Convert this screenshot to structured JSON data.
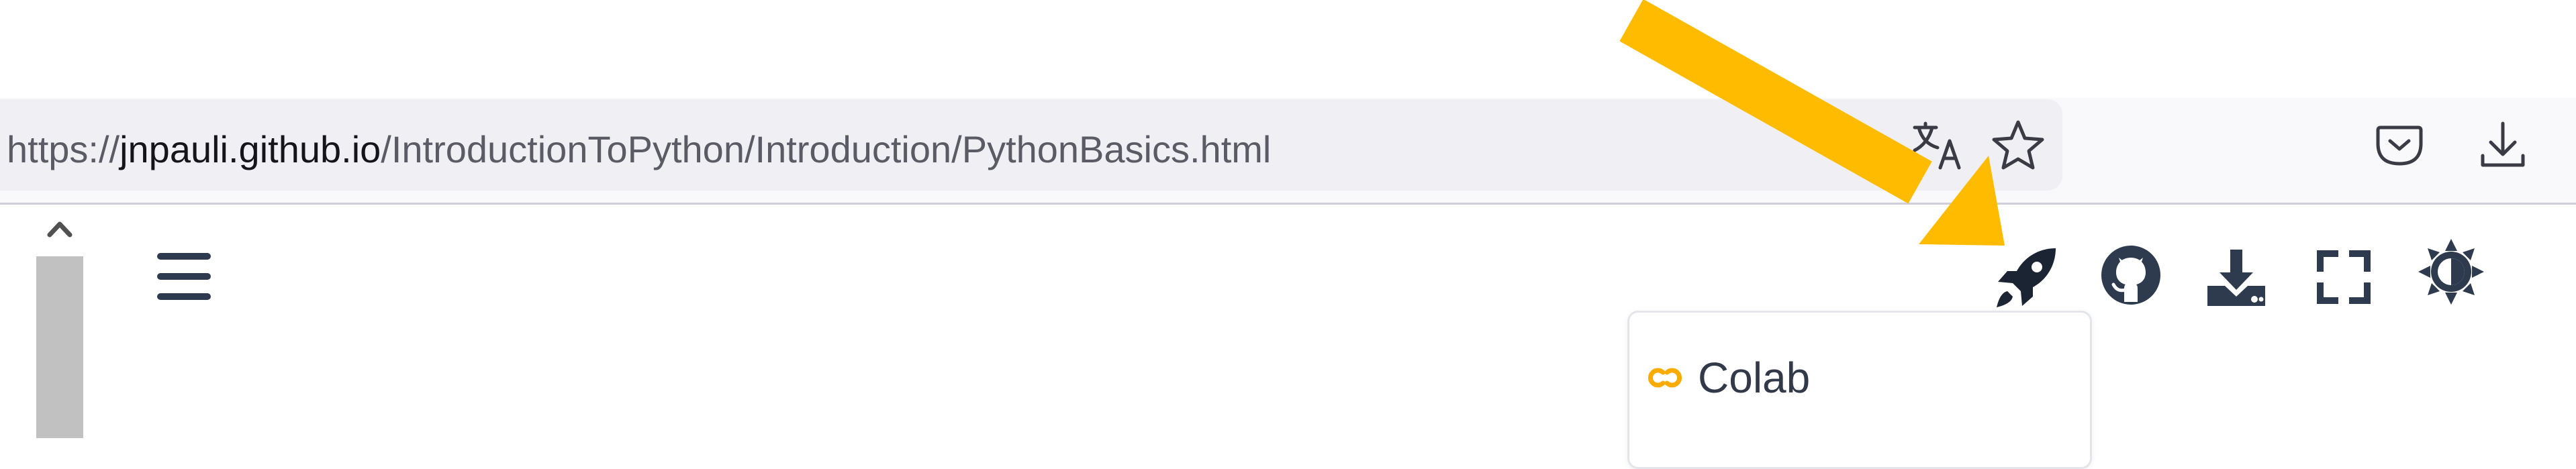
{
  "browser": {
    "url_prefix": "https://",
    "url_host": "jnpauli.github.io",
    "url_path": "/IntroductionToPython/Introduction/PythonBasics.html",
    "icons": [
      "translate-icon",
      "bookmark-star-icon",
      "pocket-icon",
      "downloads-icon"
    ]
  },
  "page": {
    "header_icons": [
      "menu-icon",
      "launch-rocket-icon",
      "github-icon",
      "download-icon",
      "fullscreen-icon",
      "theme-toggle-icon"
    ],
    "launch_menu": {
      "items": [
        {
          "label": "Colab",
          "icon": "colab-icon"
        }
      ]
    }
  },
  "annotation": {
    "color": "#ffbb00",
    "type": "arrow"
  }
}
